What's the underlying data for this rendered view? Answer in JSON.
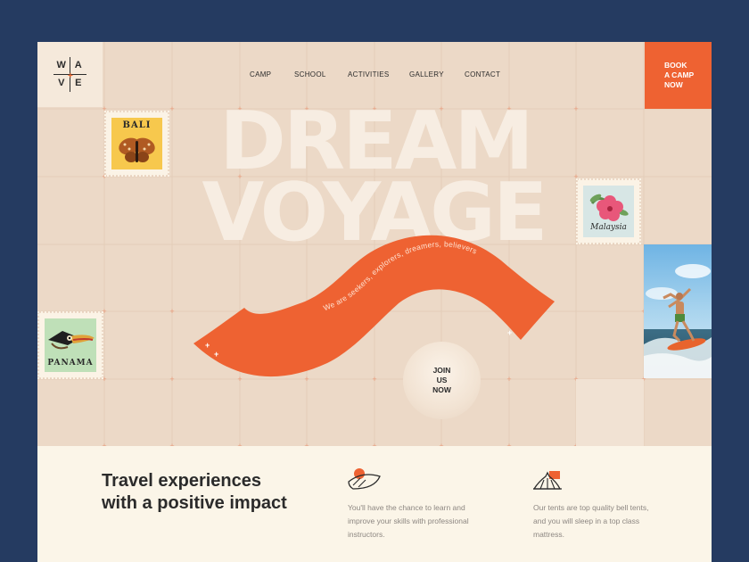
{
  "brand": {
    "letters": [
      "W",
      "A",
      "V",
      "E"
    ],
    "mark": "+"
  },
  "nav": {
    "items": [
      "CAMP",
      "SCHOOL",
      "ACTIVITIES",
      "GALLERY",
      "CONTACT"
    ]
  },
  "cta": {
    "label_lines": [
      "BOOK",
      "A CAMP",
      "NOW"
    ]
  },
  "hero": {
    "title_line1": "DREAM",
    "title_line2": "VOYAGE",
    "ribbon_text": "We are seekers, explorers, dreamers, believers",
    "join_lines": [
      "JOIN",
      "US",
      "NOW"
    ]
  },
  "stamps": [
    {
      "label": "BALI",
      "icon": "butterfly-icon"
    },
    {
      "label": "Malaysia",
      "icon": "hibiscus-icon"
    },
    {
      "label": "PANAMA",
      "icon": "toucan-icon"
    }
  ],
  "photo": {
    "icon": "surfer-photo"
  },
  "intro": {
    "headline": "Travel experiences with a positive impact"
  },
  "features": [
    {
      "icon": "surfboard-icon",
      "text": "You'll have the chance to learn and improve your skills with professional instructors."
    },
    {
      "icon": "tent-icon",
      "text": "Our tents are top quality bell tents, and you will sleep in a top class mattress."
    }
  ],
  "colors": {
    "background": "#253b61",
    "hero": "#ecd9c7",
    "accent": "#ee6232",
    "cream": "#fbf5e8",
    "text": "#2b2b2b"
  }
}
